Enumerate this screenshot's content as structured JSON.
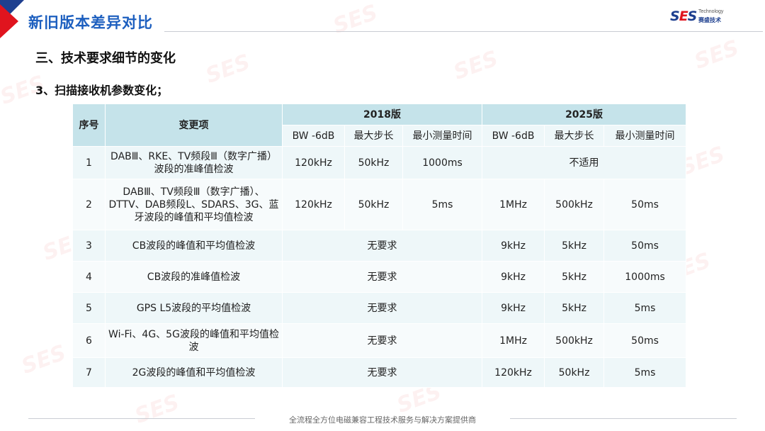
{
  "header": {
    "title": "新旧版本差异对比",
    "logo_text": "SES",
    "logo_sub": "Technology",
    "logo_cn": "赛盛技术"
  },
  "section_heading": "三、技术要求细节的变化",
  "sub_heading": "3、扫描接收机参数变化；",
  "table": {
    "col_seq": "序号",
    "col_item": "变更项",
    "group_2018": "2018版",
    "group_2025": "2025版",
    "sub_headers": [
      "BW -6dB",
      "最大步长",
      "最小测量时间",
      "BW -6dB",
      "最大步长",
      "最小测量时间"
    ],
    "rows": [
      {
        "seq": "1",
        "item": "DABⅢ、RKE、TV频段Ⅲ（数字广播）波段的准峰值检波",
        "v2018": [
          "120kHz",
          "50kHz",
          "1000ms"
        ],
        "v2025_merged": "不适用"
      },
      {
        "seq": "2",
        "item": "DABⅢ、TV频段Ⅲ（数字广播）、DTTV、DAB频段L、SDARS、3G、蓝牙波段的峰值和平均值检波",
        "v2018": [
          "120kHz",
          "50kHz",
          "5ms"
        ],
        "v2025": [
          "1MHz",
          "500kHz",
          "50ms"
        ]
      },
      {
        "seq": "3",
        "item": "CB波段的峰值和平均值检波",
        "v2018_merged": "无要求",
        "v2025": [
          "9kHz",
          "5kHz",
          "50ms"
        ]
      },
      {
        "seq": "4",
        "item": "CB波段的准峰值检波",
        "v2018_merged": "无要求",
        "v2025": [
          "9kHz",
          "5kHz",
          "1000ms"
        ]
      },
      {
        "seq": "5",
        "item": "GPS L5波段的平均值检波",
        "v2018_merged": "无要求",
        "v2025": [
          "9kHz",
          "5kHz",
          "5ms"
        ]
      },
      {
        "seq": "6",
        "item": "Wi-Fi、4G、5G波段的峰值和平均值检波",
        "v2018_merged": "无要求",
        "v2025": [
          "1MHz",
          "500kHz",
          "50ms"
        ]
      },
      {
        "seq": "7",
        "item": "2G波段的峰值和平均值检波",
        "v2018_merged": "无要求",
        "v2025": [
          "120kHz",
          "50kHz",
          "5ms"
        ]
      }
    ]
  },
  "footer": "全流程全方位电磁兼容工程技术服务与解决方案提供商",
  "colors": {
    "accent_blue": "#1d5fbf",
    "accent_red": "#e0141e",
    "header_fill": "#c5e3ea",
    "row_fill": "#eef7f9"
  }
}
